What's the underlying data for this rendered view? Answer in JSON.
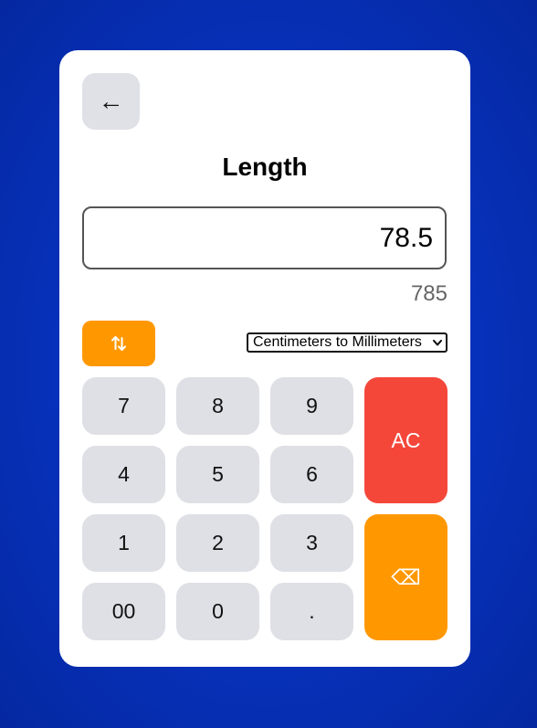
{
  "header": {
    "back_label": "←",
    "title": "Length"
  },
  "converter": {
    "input_value": "78.5",
    "result_value": "785",
    "selected_conversion": "Centimeters to Millimeters"
  },
  "keypad": {
    "k7": "7",
    "k8": "8",
    "k9": "9",
    "k4": "4",
    "k5": "5",
    "k6": "6",
    "k1": "1",
    "k2": "2",
    "k3": "3",
    "k00": "00",
    "k0": "0",
    "kdot": ".",
    "clear": "AC",
    "backspace": "⌫"
  },
  "colors": {
    "background": "#0633c0",
    "card": "#ffffff",
    "key": "#dfe0e5",
    "accent": "#ff9800",
    "clear": "#f4473a"
  },
  "icons": {
    "swap": "swap-vertical-icon",
    "back": "arrow-left-icon",
    "backspace": "backspace-icon",
    "dropdown": "chevron-down-icon"
  }
}
